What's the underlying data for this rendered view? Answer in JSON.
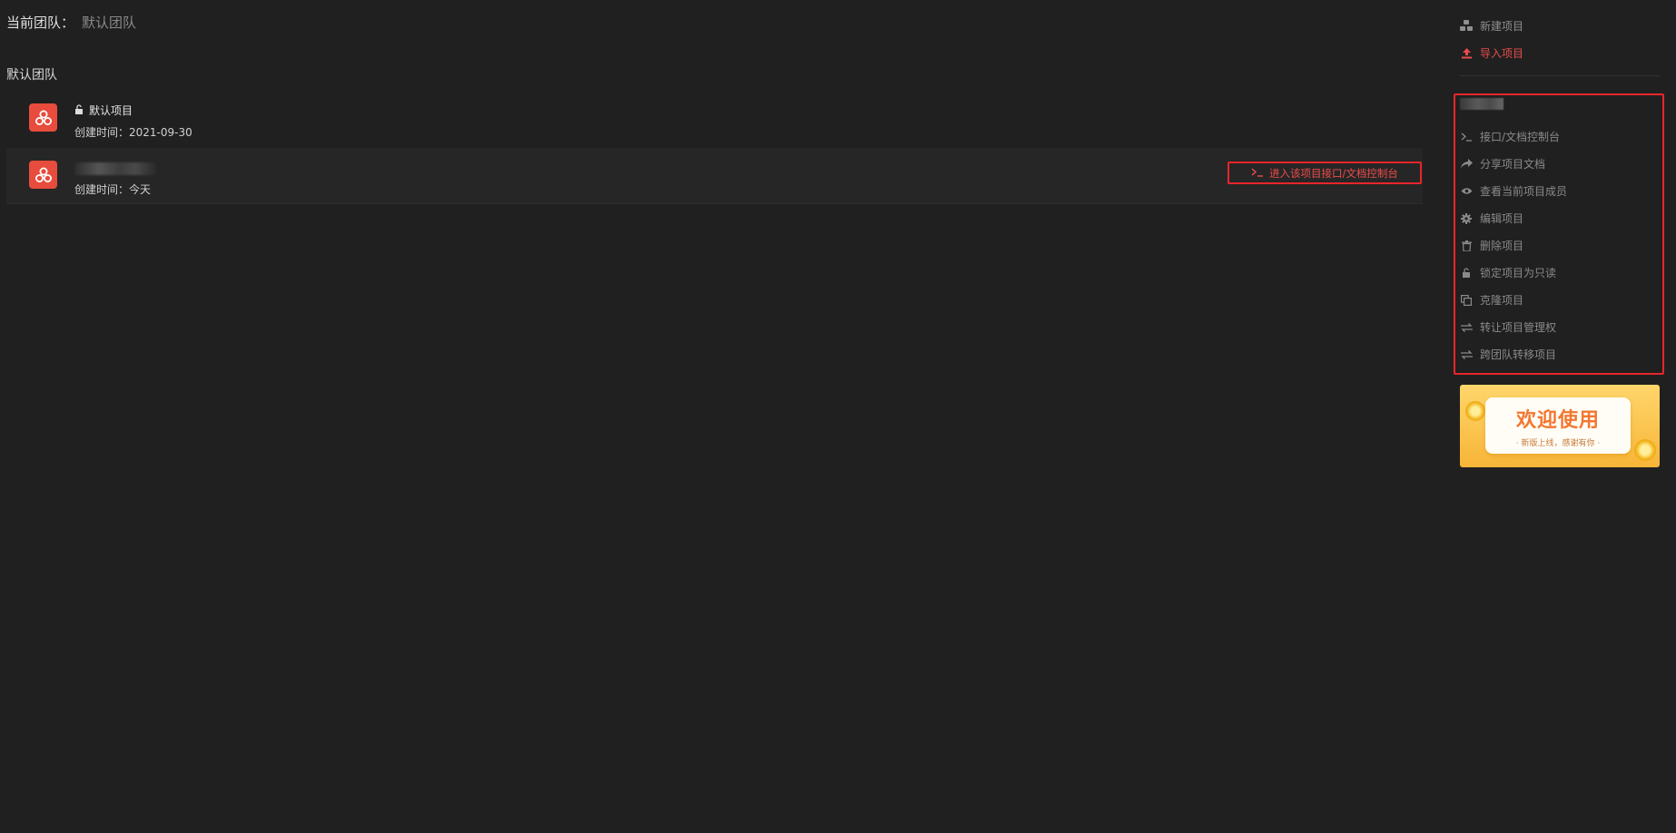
{
  "header": {
    "current_team_label": "当前团队：",
    "current_team_value": "默认团队"
  },
  "team": {
    "name": "默认团队"
  },
  "projects": [
    {
      "title": "默认项目",
      "created": "创建时间：2021-09-30",
      "locked_icon": "unlock-icon"
    },
    {
      "title": "",
      "created": "创建时间：今天",
      "action_label": "进入该项目接口/文档控制台"
    }
  ],
  "sidebar": {
    "new_project": "新建项目",
    "import_project": "导入项目",
    "menu": [
      {
        "label": "接口/文档控制台",
        "icon": "terminal-icon"
      },
      {
        "label": "分享项目文档",
        "icon": "share-icon"
      },
      {
        "label": "查看当前项目成员",
        "icon": "eye-icon"
      },
      {
        "label": "编辑项目",
        "icon": "gear-icon"
      },
      {
        "label": "删除项目",
        "icon": "trash-icon"
      },
      {
        "label": "锁定项目为只读",
        "icon": "unlock-icon"
      },
      {
        "label": "克隆项目",
        "icon": "copy-icon"
      },
      {
        "label": "转让项目管理权",
        "icon": "transfer-icon"
      },
      {
        "label": "跨团队转移项目",
        "icon": "transfer-icon"
      }
    ]
  },
  "banner": {
    "title": "欢迎使用",
    "subtitle": "· 新版上线，感谢有你 ·"
  },
  "colors": {
    "background": "#202020",
    "accent": "#e8252b",
    "logo": "#e74c3c",
    "banner": "#f7b538"
  }
}
